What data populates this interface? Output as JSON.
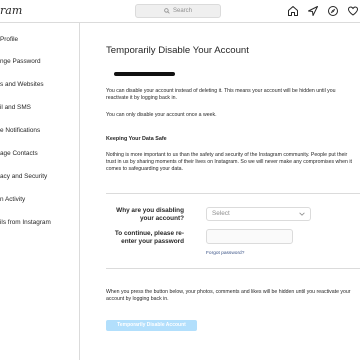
{
  "header": {
    "logo": "ram",
    "search_placeholder": "Search",
    "icons": [
      "home-icon",
      "explore-icon",
      "compass-icon",
      "heart-icon"
    ]
  },
  "sidebar": {
    "items": [
      {
        "label": "Profile"
      },
      {
        "label": "nge Password"
      },
      {
        "label": "s and Websites"
      },
      {
        "label": "il and SMS"
      },
      {
        "label": "e Notifications"
      },
      {
        "label": "age Contacts"
      },
      {
        "label": "acy and Security"
      },
      {
        "label": "n Activity"
      },
      {
        "label": "ils from Instagram"
      }
    ]
  },
  "main": {
    "title": "Temporarily Disable Your Account",
    "intro": "You can disable your account instead of deleting it. This means your account will be hidden until you reactivate it by logging back in.",
    "once_week": "You can only disable your account once a week.",
    "safe_heading": "Keeping Your Data Safe",
    "safe_text": "Nothing is more important to us than the safety and security of the Instagram community. People put their trust in us by sharing moments of their lives on Instagram. So we will never make any compromises when it comes to safeguarding your data.",
    "reason_label_1": "Why are you disabling",
    "reason_label_2": "your account?",
    "reason_select_value": "Select",
    "password_label_1": "To continue, please re-",
    "password_label_2": "enter your password",
    "forgot_password": "Forgot password?",
    "footer_text": "When you press the button below, your photos, comments and likes will be hidden until you reactivate your account by logging back in.",
    "disable_button": "Temporarily Disable Account"
  },
  "colors": {
    "button": "#b2dffc",
    "link": "#385185",
    "border": "#dbdbdb"
  }
}
